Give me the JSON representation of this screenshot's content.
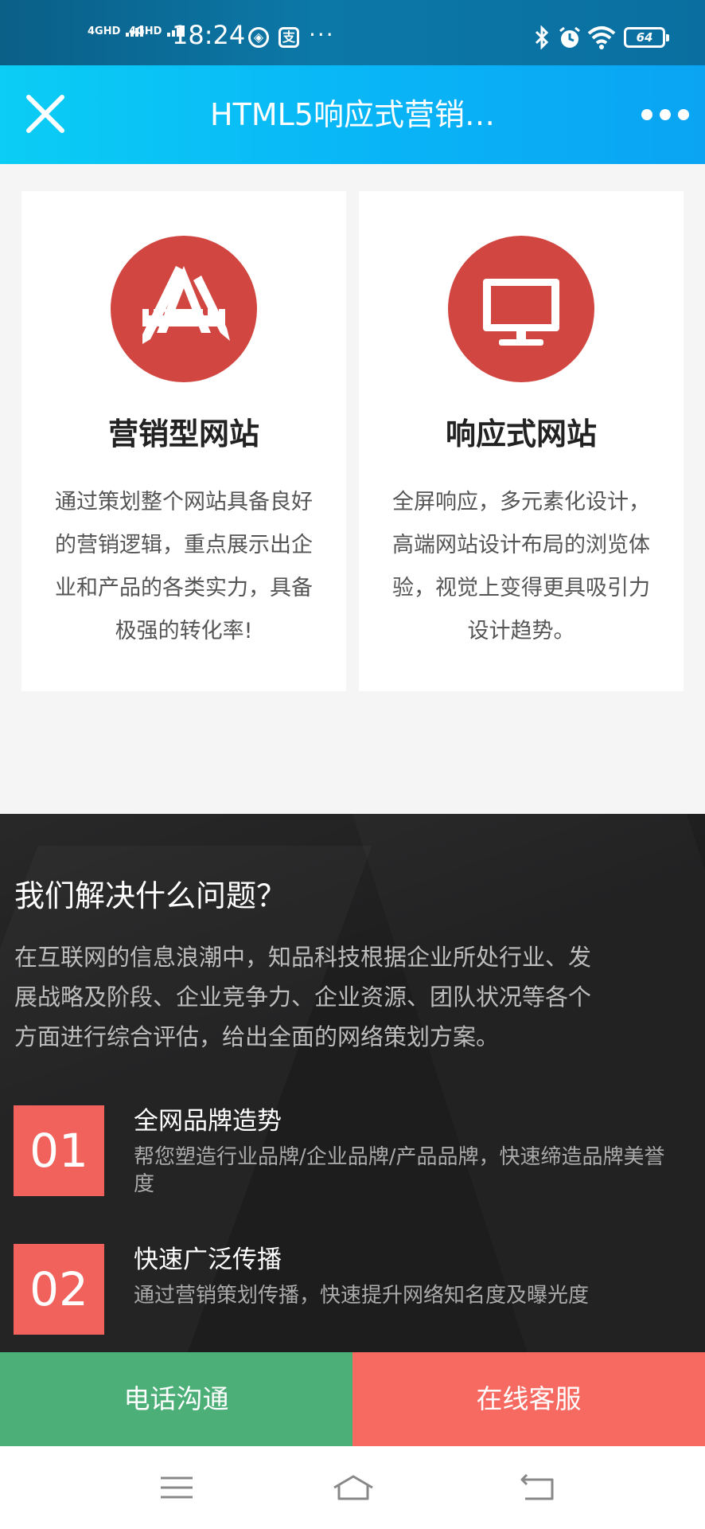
{
  "status_bar": {
    "signal1": "4GHD",
    "signal2": "4GHD",
    "time": "18:24",
    "app_icon1": "◈",
    "app_icon2": "支",
    "more_dots": "···",
    "battery": "64",
    "icons": [
      "bluetooth-icon",
      "alarm-icon",
      "wifi-icon",
      "battery-icon"
    ]
  },
  "header": {
    "title": "HTML5响应式营销…",
    "close_icon": "close-icon",
    "more_icon": "more-icon",
    "colors": {
      "start": "#0bcdf5",
      "end": "#0aa4f3"
    }
  },
  "cards": [
    {
      "icon": "design-tools-icon",
      "title": "营销型网站",
      "lines": [
        "通过策划整个网站具备良好",
        "的营销逻辑，重点展示出企",
        "业和产品的各类实力，具备",
        "极强的转化率!"
      ]
    },
    {
      "icon": "monitor-icon",
      "title": "响应式网站",
      "lines": [
        "全屏响应，多元素化设计，",
        "高端网站设计布局的浏览体",
        "验，视觉上变得更具吸引力",
        "设计趋势。"
      ]
    }
  ],
  "problems": {
    "title": "我们解决什么问题？",
    "lines": [
      "在互联网的信息浪潮中，知品科技根据企业所处行业、发",
      "展战略及阶段、企业竞争力、企业资源、团队状况等各个",
      "方面进行综合评估，给出全面的网络策划方案。"
    ],
    "items": [
      {
        "num": "01",
        "title": "全网品牌造势",
        "desc": "帮您塑造行业品牌/企业品牌/产品品牌，快速缔造品牌美誉度"
      },
      {
        "num": "02",
        "title": "快速广泛传播",
        "desc": "通过营销策划传播，快速提升网络知名度及曝光度"
      }
    ]
  },
  "bottom_actions": {
    "call": "电话沟通",
    "service": "在线客服",
    "colors": {
      "call": "#4caf77",
      "service": "#f76a62"
    }
  },
  "nav": {
    "icons": [
      "menu-icon",
      "home-icon",
      "back-icon"
    ]
  },
  "colors": {
    "accent_red": "#d14640",
    "number_red": "#f0625b"
  }
}
